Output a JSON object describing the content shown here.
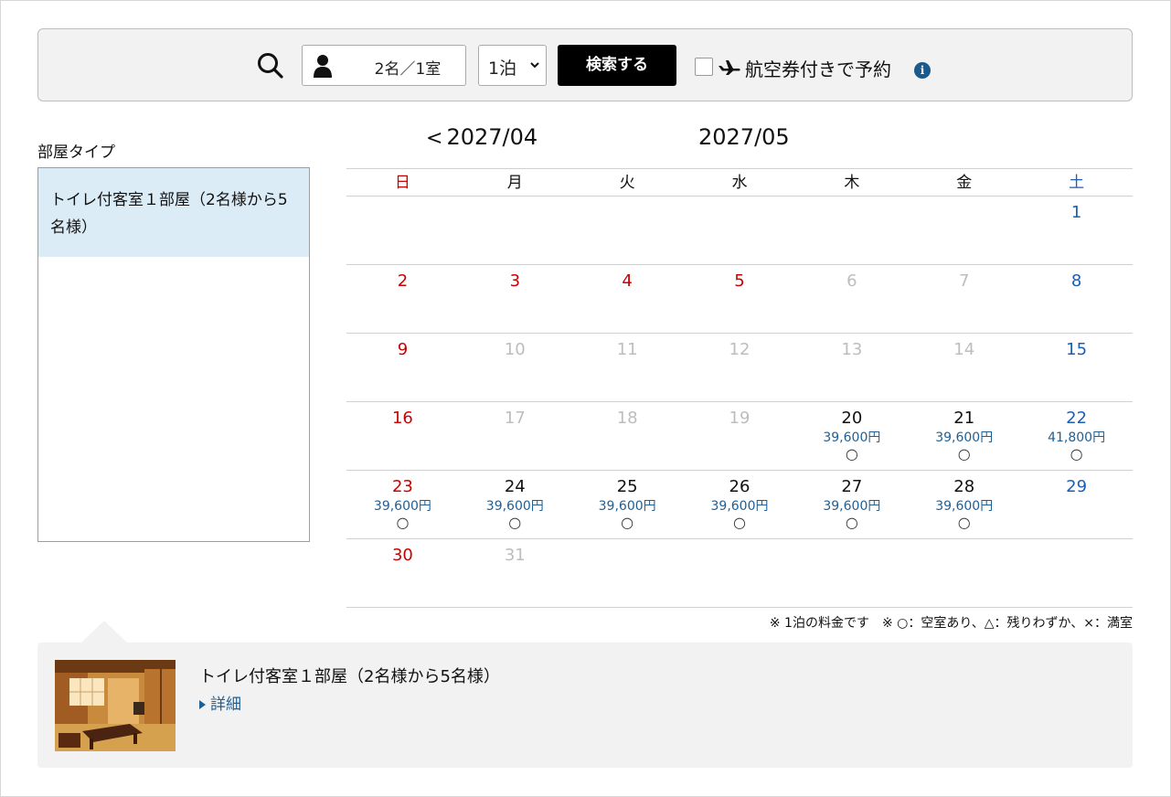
{
  "search": {
    "guests": "2名／1室",
    "nights": "1泊",
    "button": "検索する",
    "flight_label": "航空券付きで予約",
    "info": "i"
  },
  "room_type": {
    "title": "部屋タイプ",
    "items": [
      "トイレ付客室１部屋（2名様から5名様）"
    ]
  },
  "calendar": {
    "prev_month": "2027/04",
    "prev_arrow": "<",
    "current_month": "2027/05",
    "weekdays": [
      "日",
      "月",
      "火",
      "水",
      "木",
      "金",
      "土"
    ],
    "weeks": [
      [
        null,
        null,
        null,
        null,
        null,
        null,
        {
          "day": "1",
          "kind": "sat"
        }
      ],
      [
        {
          "day": "2",
          "kind": "sun"
        },
        {
          "day": "3",
          "kind": "sun"
        },
        {
          "day": "4",
          "kind": "sun"
        },
        {
          "day": "5",
          "kind": "sun"
        },
        {
          "day": "6",
          "kind": "mut"
        },
        {
          "day": "7",
          "kind": "mut"
        },
        {
          "day": "8",
          "kind": "sat"
        }
      ],
      [
        {
          "day": "9",
          "kind": "sun"
        },
        {
          "day": "10",
          "kind": "mut"
        },
        {
          "day": "11",
          "kind": "mut"
        },
        {
          "day": "12",
          "kind": "mut"
        },
        {
          "day": "13",
          "kind": "mut"
        },
        {
          "day": "14",
          "kind": "mut"
        },
        {
          "day": "15",
          "kind": "sat"
        }
      ],
      [
        {
          "day": "16",
          "kind": "sun"
        },
        {
          "day": "17",
          "kind": "mut"
        },
        {
          "day": "18",
          "kind": "mut"
        },
        {
          "day": "19",
          "kind": "mut"
        },
        {
          "day": "20",
          "kind": "avl",
          "price": "39,600円",
          "status": "○"
        },
        {
          "day": "21",
          "kind": "avl",
          "price": "39,600円",
          "status": "○"
        },
        {
          "day": "22",
          "kind": "sat",
          "price": "41,800円",
          "status": "○"
        }
      ],
      [
        {
          "day": "23",
          "kind": "sun",
          "price": "39,600円",
          "status": "○"
        },
        {
          "day": "24",
          "kind": "avl",
          "price": "39,600円",
          "status": "○"
        },
        {
          "day": "25",
          "kind": "avl",
          "price": "39,600円",
          "status": "○"
        },
        {
          "day": "26",
          "kind": "avl",
          "price": "39,600円",
          "status": "○"
        },
        {
          "day": "27",
          "kind": "avl",
          "price": "39,600円",
          "status": "○"
        },
        {
          "day": "28",
          "kind": "avl",
          "price": "39,600円",
          "status": "○"
        },
        {
          "day": "29",
          "kind": "sat"
        }
      ],
      [
        {
          "day": "30",
          "kind": "sun"
        },
        {
          "day": "31",
          "kind": "mut"
        },
        null,
        null,
        null,
        null,
        null
      ]
    ],
    "legend": "※ 1泊の料金です　※ ○：空室あり、△：残りわずか、×：満室"
  },
  "detail": {
    "room_name": "トイレ付客室１部屋（2名様から5名様）",
    "link": "詳細"
  },
  "colors": {
    "sunday": "#cc0000",
    "saturday": "#1a5fb4",
    "muted": "#bdbdbd",
    "price": "#1f5f94",
    "selected_bg": "#dcecf7"
  }
}
